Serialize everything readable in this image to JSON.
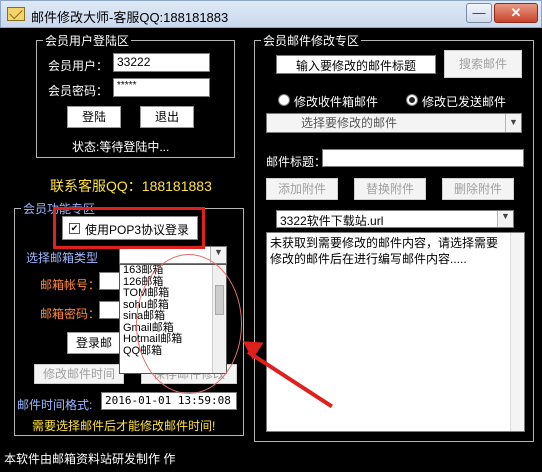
{
  "window": {
    "title": "邮件修改大师-客服QQ:188181883",
    "minimize_label": "—",
    "close_label": "✕"
  },
  "login": {
    "group_title": "会员用户登陆区",
    "user_label": "会员用户：",
    "user_value": "33222",
    "password_label": "会员密码：",
    "password_value": "*****",
    "login_button": "登陆",
    "logout_button": "退出",
    "status_text": "状态:等待登陆中..."
  },
  "contact_text": "联系客服QQ：188181883",
  "features": {
    "group_title": "会员功能专区",
    "pop3_checkbox_label": "使用POP3协议登录",
    "pop3_checked": true,
    "mailbox_type_label": "选择邮箱类型",
    "account_label": "邮箱帐号：",
    "password_label": "邮箱密码：",
    "login_mailbox_button": "登录邮",
    "modify_time_button": "修改邮件时间",
    "save_modify_button": "保存邮件修改",
    "time_format_label": "邮件时间格式:",
    "time_value": "2016-01-01 13:59:08",
    "warning_text": "需要选择邮件后才能修改邮件时间!",
    "mailbox_options": [
      "163邮箱",
      "126邮箱",
      "TOM邮箱",
      "sohu邮箱",
      "sina邮箱",
      "Gmail邮箱",
      "Hotmail邮箱",
      "QQ邮箱"
    ]
  },
  "edit": {
    "group_title": "会员邮件修改专区",
    "subject_search_value": "输入要修改的邮件标题",
    "search_button": "搜索邮件",
    "radio_inbox_label": "修改收件箱邮件",
    "radio_sent_label": "修改已发送邮件",
    "select_mail_placeholder": "选择要修改的邮件",
    "subject_label": "邮件标题：",
    "add_attachment_button": "添加附件",
    "replace_attachment_button": "替换附件",
    "delete_attachment_button": "删除附件",
    "attachment_value": "3322软件下载站.url",
    "body_text": "未获取到需要修改的邮件内容，请选择需要修改的邮件后在进行编写邮件内容....."
  },
  "footer": {
    "text": "本软件由邮箱资料站研发制作 作"
  }
}
